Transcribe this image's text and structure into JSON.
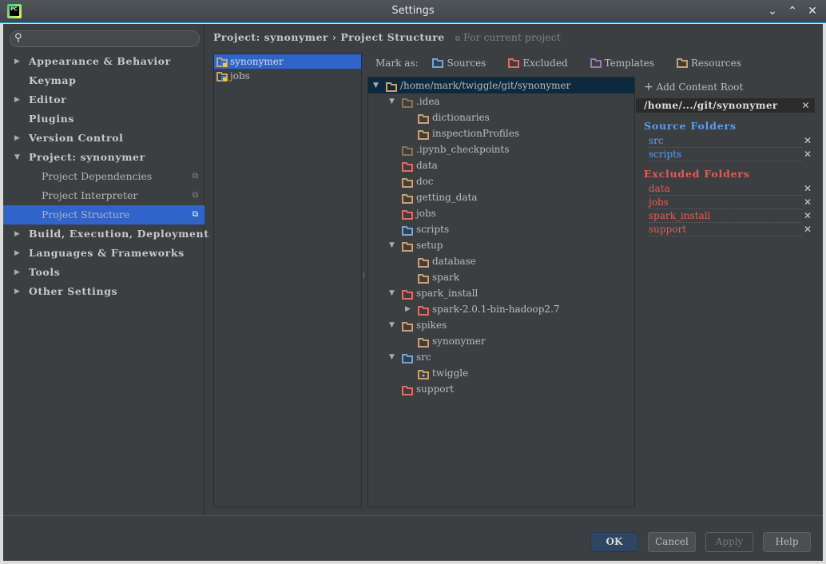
{
  "window": {
    "title": "Settings",
    "app_icon_text": "PC"
  },
  "search": {
    "placeholder": "",
    "value": ""
  },
  "sidebar": {
    "items": [
      {
        "label": "Appearance & Behavior",
        "expandable": true,
        "expanded": false
      },
      {
        "label": "Keymap",
        "expandable": false
      },
      {
        "label": "Editor",
        "expandable": true,
        "expanded": false
      },
      {
        "label": "Plugins",
        "expandable": false
      },
      {
        "label": "Version Control",
        "expandable": true,
        "expanded": false
      },
      {
        "label": "Project: synonymer",
        "expandable": true,
        "expanded": true
      },
      {
        "label": "Project Dependencies",
        "sub": true
      },
      {
        "label": "Project Interpreter",
        "sub": true
      },
      {
        "label": "Project Structure",
        "sub": true,
        "selected": true
      },
      {
        "label": "Build, Execution, Deployment",
        "expandable": true,
        "expanded": false
      },
      {
        "label": "Languages & Frameworks",
        "expandable": true,
        "expanded": false
      },
      {
        "label": "Tools",
        "expandable": true,
        "expanded": false
      },
      {
        "label": "Other Settings",
        "expandable": true,
        "expanded": false
      }
    ]
  },
  "breadcrumb": {
    "parent": "Project: synonymer",
    "separator": "›",
    "current": "Project Structure",
    "note": "For current project"
  },
  "modules": [
    {
      "label": "synonymer",
      "selected": true
    },
    {
      "label": "jobs"
    }
  ],
  "mark_as": {
    "label": "Mark as:",
    "options": [
      {
        "label": "Sources",
        "color": "#6fa8dc"
      },
      {
        "label": "Excluded",
        "color": "#e06c65"
      },
      {
        "label": "Templates",
        "color": "#a274b8"
      },
      {
        "label": "Resources",
        "color": "#c9a26d"
      }
    ]
  },
  "tree": [
    {
      "label": "/home/mark/twiggle/git/synonymer",
      "level": 0,
      "arrow": "down",
      "kind": "normal",
      "selected": true
    },
    {
      "label": ".idea",
      "level": 1,
      "arrow": "down",
      "kind": "idea"
    },
    {
      "label": "dictionaries",
      "level": 2,
      "kind": "normal"
    },
    {
      "label": "inspectionProfiles",
      "level": 2,
      "kind": "normal"
    },
    {
      "label": ".ipynb_checkpoints",
      "level": 1,
      "kind": "idea"
    },
    {
      "label": "data",
      "level": 1,
      "kind": "excluded"
    },
    {
      "label": "doc",
      "level": 1,
      "kind": "normal"
    },
    {
      "label": "getting_data",
      "level": 1,
      "kind": "normal"
    },
    {
      "label": "jobs",
      "level": 1,
      "kind": "excluded"
    },
    {
      "label": "scripts",
      "level": 1,
      "kind": "source"
    },
    {
      "label": "setup",
      "level": 1,
      "arrow": "down",
      "kind": "normal"
    },
    {
      "label": "database",
      "level": 2,
      "kind": "normal"
    },
    {
      "label": "spark",
      "level": 2,
      "kind": "normal"
    },
    {
      "label": "spark_install",
      "level": 1,
      "arrow": "down",
      "kind": "excluded"
    },
    {
      "label": "spark-2.0.1-bin-hadoop2.7",
      "level": 2,
      "arrow": "right",
      "kind": "excluded"
    },
    {
      "label": "spikes",
      "level": 1,
      "arrow": "down",
      "kind": "normal"
    },
    {
      "label": "synonymer",
      "level": 2,
      "kind": "normal"
    },
    {
      "label": "src",
      "level": 1,
      "arrow": "down",
      "kind": "source"
    },
    {
      "label": "twiggle",
      "level": 2,
      "kind": "package"
    },
    {
      "label": "support",
      "level": 1,
      "kind": "excluded"
    }
  ],
  "folder_colors": {
    "normal": "#c9a26d",
    "idea": "#8a7257",
    "excluded": "#e06c65",
    "source": "#6fa8dc",
    "package": "#c9a26d"
  },
  "content_roots": {
    "add_label": "Add Content Root",
    "root": "/home/.../git/synonymer",
    "source_title": "Source Folders",
    "source_color": "#5c9df0",
    "source_folders": [
      "src",
      "scripts"
    ],
    "excluded_title": "Excluded Folders",
    "excluded_color": "#e55a5a",
    "excluded_folders": [
      "data",
      "jobs",
      "spark_install",
      "support"
    ]
  },
  "buttons": {
    "ok": "OK",
    "cancel": "Cancel",
    "apply": "Apply",
    "help": "Help"
  }
}
